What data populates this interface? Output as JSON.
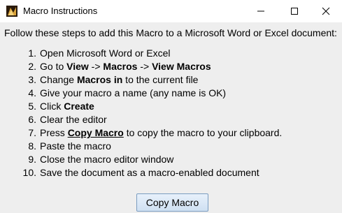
{
  "window": {
    "title": "Macro Instructions",
    "controls": {
      "minimize_icon": "minimize-icon",
      "maximize_icon": "maximize-icon",
      "close_icon": "close-icon"
    }
  },
  "intro": "Follow these steps to add this Macro to a Microsoft Word or Excel document:",
  "steps": [
    {
      "num": "1.",
      "parts": [
        {
          "t": "Open Microsoft Word or Excel"
        }
      ]
    },
    {
      "num": "2.",
      "parts": [
        {
          "t": "Go to "
        },
        {
          "t": "View",
          "b": true
        },
        {
          "t": " -> "
        },
        {
          "t": "Macros",
          "b": true
        },
        {
          "t": " -> "
        },
        {
          "t": "View Macros",
          "b": true
        }
      ]
    },
    {
      "num": "3.",
      "parts": [
        {
          "t": "Change "
        },
        {
          "t": "Macros in",
          "b": true
        },
        {
          "t": " to the current file"
        }
      ]
    },
    {
      "num": "4.",
      "parts": [
        {
          "t": "Give your macro a name (any name is OK)"
        }
      ]
    },
    {
      "num": "5.",
      "parts": [
        {
          "t": "Click "
        },
        {
          "t": "Create",
          "b": true
        }
      ]
    },
    {
      "num": "6.",
      "parts": [
        {
          "t": "Clear the editor"
        }
      ]
    },
    {
      "num": "7.",
      "parts": [
        {
          "t": "Press "
        },
        {
          "t": "Copy Macro",
          "b": true,
          "u": true
        },
        {
          "t": " to copy the macro to your clipboard."
        }
      ]
    },
    {
      "num": "8.",
      "parts": [
        {
          "t": "Paste the macro"
        }
      ]
    },
    {
      "num": "9.",
      "parts": [
        {
          "t": "Close the macro editor window"
        }
      ]
    },
    {
      "num": "10.",
      "parts": [
        {
          "t": "Save the document as a macro-enabled document"
        }
      ]
    }
  ],
  "button": {
    "label": "Copy Macro"
  }
}
